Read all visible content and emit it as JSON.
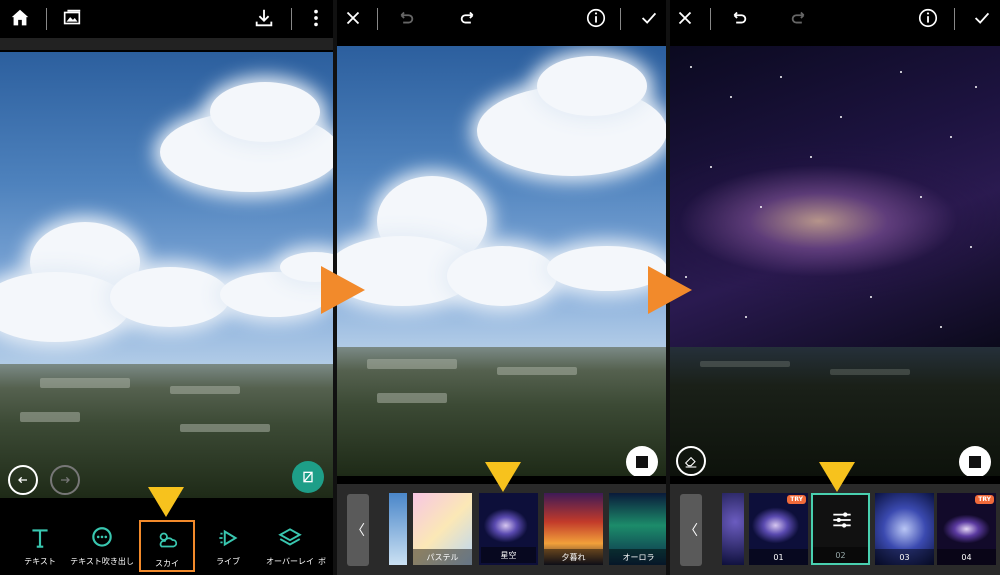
{
  "panel1": {
    "toolbar": [
      {
        "label": "テキスト",
        "icon": "text-icon"
      },
      {
        "label": "テキスト吹き出し",
        "icon": "speech-bubble-icon"
      },
      {
        "label": "スカイ",
        "icon": "sky-icon",
        "selected": true
      },
      {
        "label": "ライブ",
        "icon": "live-icon"
      },
      {
        "label": "オーバーレイ",
        "icon": "overlay-icon"
      },
      {
        "label": "ボ",
        "icon": "partial-icon"
      }
    ]
  },
  "panel2": {
    "sky_options": [
      {
        "label": "パステル"
      },
      {
        "label": "星空",
        "selected": true
      },
      {
        "label": "夕暮れ"
      },
      {
        "label": "オーロラ"
      }
    ]
  },
  "panel3": {
    "presets": [
      {
        "label": "01",
        "try": "TRY"
      },
      {
        "label": "02",
        "selected": true,
        "icon": "adjust-sliders-icon"
      },
      {
        "label": "03"
      },
      {
        "label": "04",
        "try": "TRY"
      }
    ]
  },
  "colors": {
    "accent": "#f28a2b",
    "pointer": "#f7c21d",
    "selection": "#49d0b0",
    "try_badge": "#f06a3a"
  }
}
